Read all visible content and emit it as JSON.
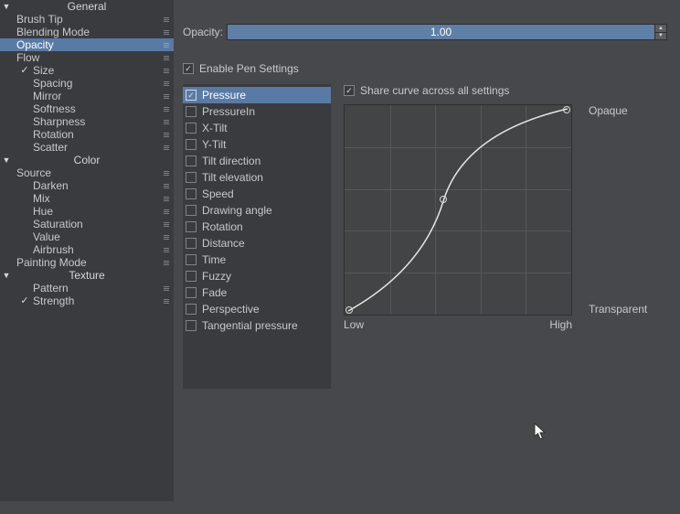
{
  "sidebar": {
    "sections": [
      {
        "title": "General",
        "items": [
          {
            "label": "Brush Tip",
            "checked": false,
            "indent": 0,
            "drag": true
          },
          {
            "label": "Blending Mode",
            "checked": false,
            "indent": 0,
            "drag": true
          },
          {
            "label": "Opacity",
            "checked": false,
            "indent": 0,
            "drag": true,
            "selected": true
          },
          {
            "label": "Flow",
            "checked": false,
            "indent": 0,
            "drag": true
          },
          {
            "label": "Size",
            "checked": true,
            "indent": 1,
            "drag": true
          },
          {
            "label": "Spacing",
            "checked": false,
            "indent": 1,
            "drag": true
          },
          {
            "label": "Mirror",
            "checked": false,
            "indent": 1,
            "drag": true
          },
          {
            "label": "Softness",
            "checked": false,
            "indent": 1,
            "drag": true
          },
          {
            "label": "Sharpness",
            "checked": false,
            "indent": 1,
            "drag": true
          },
          {
            "label": "Rotation",
            "checked": false,
            "indent": 1,
            "drag": true
          },
          {
            "label": "Scatter",
            "checked": false,
            "indent": 1,
            "drag": true
          }
        ]
      },
      {
        "title": "Color",
        "items": [
          {
            "label": "Source",
            "checked": false,
            "indent": 0,
            "drag": true
          },
          {
            "label": "Darken",
            "checked": false,
            "indent": 1,
            "drag": true
          },
          {
            "label": "Mix",
            "checked": false,
            "indent": 1,
            "drag": true
          },
          {
            "label": "Hue",
            "checked": false,
            "indent": 1,
            "drag": true
          },
          {
            "label": "Saturation",
            "checked": false,
            "indent": 1,
            "drag": true
          },
          {
            "label": "Value",
            "checked": false,
            "indent": 1,
            "drag": true
          },
          {
            "label": "Airbrush",
            "checked": false,
            "indent": 1,
            "drag": true
          },
          {
            "label": "Painting Mode",
            "checked": false,
            "indent": 0,
            "drag": true
          }
        ]
      },
      {
        "title": "Texture",
        "items": [
          {
            "label": "Pattern",
            "checked": false,
            "indent": 1,
            "drag": true
          },
          {
            "label": "Strength",
            "checked": true,
            "indent": 1,
            "drag": true
          }
        ]
      }
    ]
  },
  "opacity": {
    "label": "Opacity:",
    "value": "1.00"
  },
  "enable_pen": {
    "label": "Enable Pen Settings",
    "checked": true
  },
  "share_curve": {
    "label": "Share curve across all settings",
    "checked": true
  },
  "sensors": [
    {
      "label": "Pressure",
      "checked": true,
      "selected": true
    },
    {
      "label": "PressureIn",
      "checked": false
    },
    {
      "label": "X-Tilt",
      "checked": false
    },
    {
      "label": "Y-Tilt",
      "checked": false
    },
    {
      "label": "Tilt direction",
      "checked": false
    },
    {
      "label": "Tilt elevation",
      "checked": false
    },
    {
      "label": "Speed",
      "checked": false
    },
    {
      "label": "Drawing angle",
      "checked": false
    },
    {
      "label": "Rotation",
      "checked": false
    },
    {
      "label": "Distance",
      "checked": false
    },
    {
      "label": "Time",
      "checked": false
    },
    {
      "label": "Fuzzy",
      "checked": false
    },
    {
      "label": "Fade",
      "checked": false
    },
    {
      "label": "Perspective",
      "checked": false
    },
    {
      "label": "Tangential pressure",
      "checked": false
    }
  ],
  "curve": {
    "y_top": "Opaque",
    "y_bottom": "Transparent",
    "x_left": "Low",
    "x_right": "High"
  }
}
